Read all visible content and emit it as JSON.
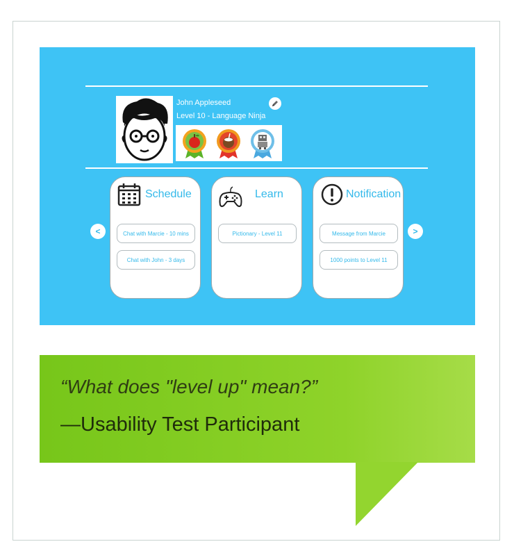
{
  "profile": {
    "name": "John Appleseed",
    "level": "Level 10 - Language Ninja",
    "avatar_icon": "cartoon-avatar-glasses",
    "badges": [
      "apple-badge-icon",
      "coconut-badge-icon",
      "robot-badge-icon"
    ]
  },
  "cards": [
    {
      "title": "Schedule",
      "icon": "calendar-icon",
      "items": [
        "Chat with Marcie - 10 mins",
        "Chat with John - 3 days"
      ]
    },
    {
      "title": "Learn",
      "icon": "gamepad-icon",
      "items": [
        "Pictionary - Level 11"
      ]
    },
    {
      "title": "Notification",
      "icon": "exclamation-icon",
      "items": [
        "Message from Marcie",
        "1000 points to Level 11"
      ]
    }
  ],
  "nav": {
    "prev": "<",
    "next": ">"
  },
  "quote": {
    "text": "“What does \"level up\" mean?”",
    "attribution": "—Usability Test Participant"
  },
  "colors": {
    "screen_bg": "#3ec3f5",
    "accent": "#33b9ea",
    "quote_bg": "#8fd32a"
  }
}
